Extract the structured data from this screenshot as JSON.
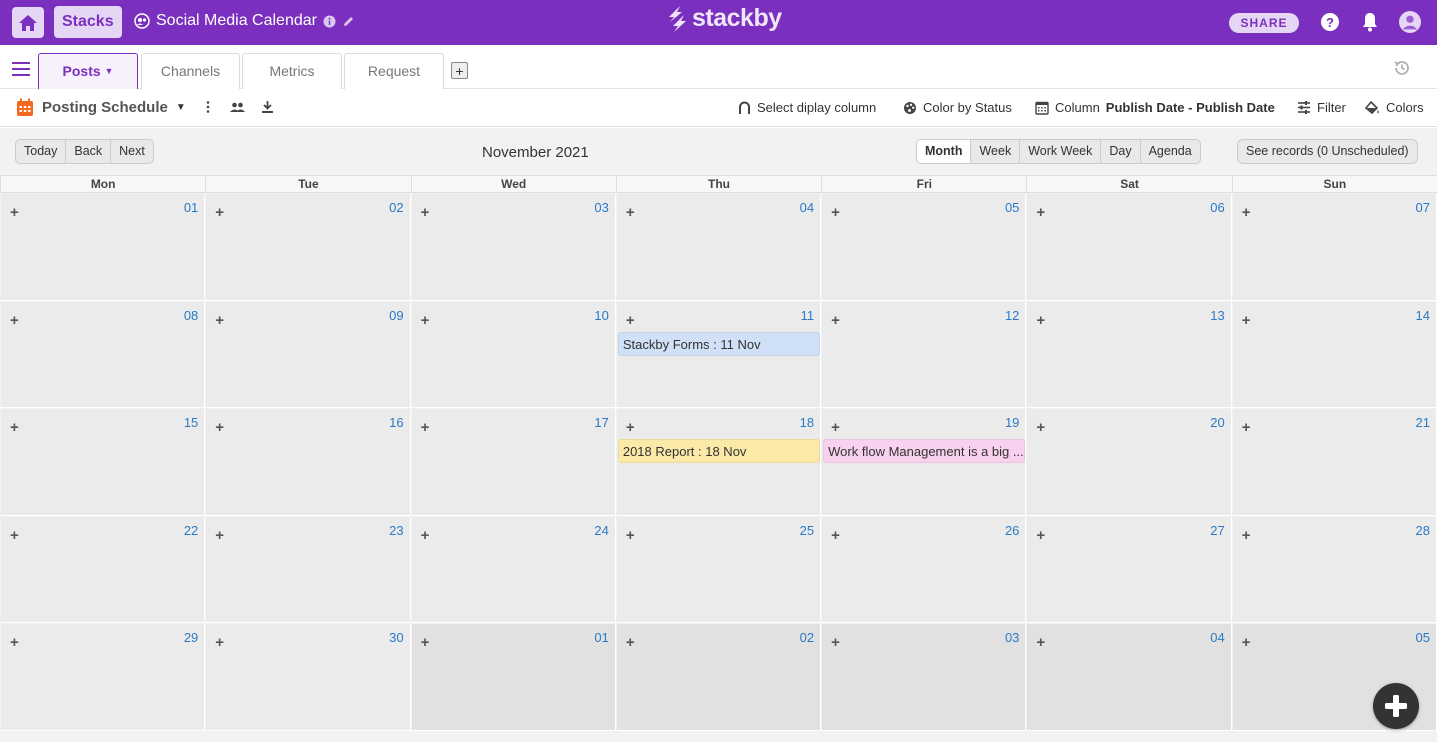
{
  "topbar": {
    "stacks_label": "Stacks",
    "stack_title": "Social Media Calendar",
    "brand": "stackby",
    "share_label": "SHARE",
    "accent_color": "#7b2fbe",
    "icons": [
      "home-icon",
      "workspace-icon",
      "info-icon",
      "edit-icon",
      "help-icon",
      "bell-icon",
      "user-avatar-icon"
    ]
  },
  "tabs": [
    {
      "label": "Posts"
    },
    {
      "label": "Channels"
    },
    {
      "label": "Metrics"
    },
    {
      "label": "Request"
    }
  ],
  "toolbar": {
    "view_name": "Posting Schedule",
    "select_column": "Select diplay column",
    "color_by": "Color by Status",
    "column_prefix": "Column",
    "column_value": "Publish Date - Publish Date",
    "filter": "Filter",
    "colors": "Colors"
  },
  "calendar": {
    "nav": [
      "Today",
      "Back",
      "Next"
    ],
    "month_label": "November 2021",
    "views": [
      "Month",
      "Week",
      "Work Week",
      "Day",
      "Agenda"
    ],
    "selected_view": "Month",
    "see_records": "See records (0 Unscheduled)",
    "weekdays": [
      "Mon",
      "Tue",
      "Wed",
      "Thu",
      "Fri",
      "Sat",
      "Sun"
    ],
    "weeks": [
      [
        "01",
        "02",
        "03",
        "04",
        "05",
        "06",
        "07"
      ],
      [
        "08",
        "09",
        "10",
        "11",
        "12",
        "13",
        "14"
      ],
      [
        "15",
        "16",
        "17",
        "18",
        "19",
        "20",
        "21"
      ],
      [
        "22",
        "23",
        "24",
        "25",
        "26",
        "27",
        "28"
      ],
      [
        "29",
        "30",
        "01",
        "02",
        "03",
        "04",
        "05"
      ]
    ],
    "events": [
      {
        "label": "Stackby Forms : 11 Nov",
        "week": 1,
        "day": 3,
        "color": "#cfe0f7"
      },
      {
        "label": "2018 Report : 18 Nov",
        "week": 2,
        "day": 3,
        "color": "#fbe9a8"
      },
      {
        "label": "Work flow Management is a big ...",
        "week": 2,
        "day": 4,
        "color": "#f8d1ee"
      }
    ]
  }
}
